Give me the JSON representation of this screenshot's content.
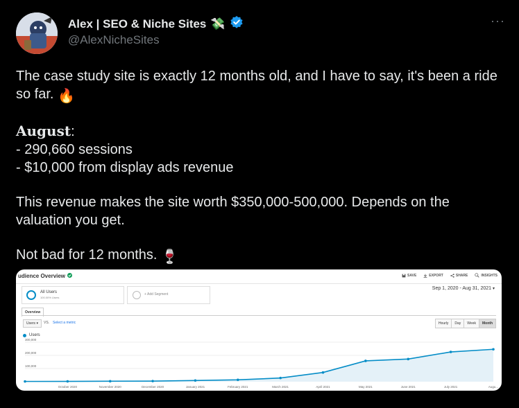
{
  "tweet": {
    "author_name": "Alex | SEO & Niche Sites",
    "author_emoji": "💸",
    "handle": "@AlexNicheSites",
    "more_label": "···",
    "line1": "The case study site is exactly 12 months old, and I have to say, it's been a ride so far.",
    "line1_emoji": "🔥",
    "month_heading": "August",
    "month_colon": ":",
    "bullet1": "- 290,660 sessions",
    "bullet2": "- $10,000 from display ads revenue",
    "line_valuation": "This revenue makes the site worth $350,000-500,000. Depends on the valuation you get.",
    "line_final": "Not bad for 12 months.",
    "line_final_emoji": "🍷"
  },
  "analytics": {
    "title": "udience Overview",
    "actions": [
      "SAVE",
      "EXPORT",
      "SHARE",
      "INSIGHTS"
    ],
    "segment_all_users": "All Users",
    "segment_all_users_sub": "100.00% Users",
    "segment_add": "+ Add Segment",
    "date_range": "Sep 1, 2020 - Aug 31, 2021",
    "tab_overview": "Overview",
    "metric_select": "Users",
    "vs_label": "VS.",
    "select_metric": "Select a metric",
    "time_buttons": [
      "Hourly",
      "Day",
      "Week",
      "Month"
    ],
    "time_active": "Month",
    "legend_label": "Users",
    "colors": {
      "line": "#058dc7",
      "area": "#e4f1f8",
      "verified": "#1d9bf0"
    }
  },
  "chart_data": {
    "type": "area",
    "series": [
      {
        "name": "Users",
        "values": [
          2000,
          2500,
          3500,
          4500,
          9000,
          14000,
          28000,
          70000,
          158000,
          172000,
          226000,
          246000
        ]
      }
    ],
    "x_tick_labels": [
      "October 2020",
      "November 2020",
      "December 2020",
      "January 2021",
      "February 2021",
      "March 2021",
      "April 2021",
      "May 2021",
      "June 2021",
      "July 2021",
      "Augu..."
    ],
    "y_ticks": [
      100000,
      200000,
      300000
    ],
    "y_tick_labels": [
      "100,000",
      "200,000",
      "300,000"
    ],
    "ylim": [
      0,
      300000
    ],
    "grid": true
  }
}
